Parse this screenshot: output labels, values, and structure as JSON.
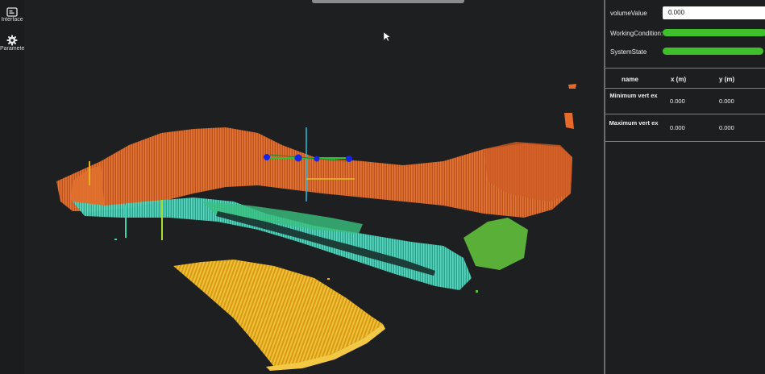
{
  "sidebar": {
    "items": [
      {
        "label": "Interface",
        "icon": "interface-window-icon"
      },
      {
        "label": "Paramete",
        "icon": "gear-icon"
      }
    ]
  },
  "panel": {
    "volume_label": "volumeValue",
    "volume_value": "0.000",
    "working_label": "WorkingCondition:",
    "system_label": "SystemState",
    "status_color": "#3fbf2a",
    "table": {
      "headers": [
        "name",
        "x (m)",
        "y (m)"
      ],
      "rows": [
        {
          "name": "Minimum vert ex",
          "x": "0.000",
          "y": "0.000"
        },
        {
          "name": "Maximum vert ex",
          "x": "0.000",
          "y": "0.000"
        }
      ]
    }
  },
  "viewport": {
    "colors": {
      "orange": "#d8642a",
      "cyan": "#3fd0b0",
      "yellow": "#e7b021",
      "gizmo_blue": "#1626e8",
      "gizmo_green": "#29c43a"
    }
  }
}
